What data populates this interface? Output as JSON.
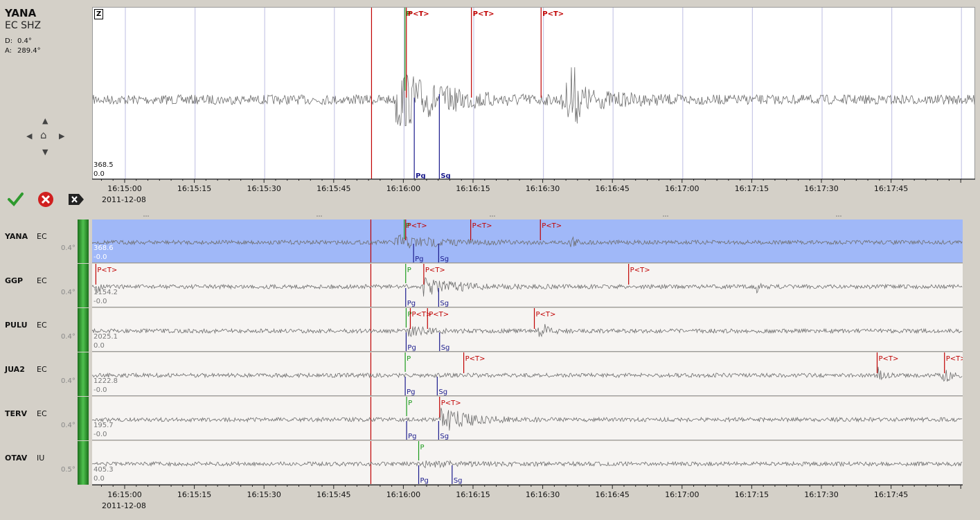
{
  "station": {
    "code": "YANA",
    "channel": "EC SHZ",
    "distance_label": "D:",
    "distance": "0.4°",
    "azimuth_label": "A:",
    "azimuth": "289.4°"
  },
  "main_trace": {
    "component": "Z",
    "amp_max": "368.5",
    "amp_min": "0.0"
  },
  "time_axis": {
    "ticks": [
      "16:15:00",
      "16:15:15",
      "16:15:30",
      "16:15:45",
      "16:16:00",
      "16:16:15",
      "16:16:30",
      "16:16:45",
      "16:17:00",
      "16:17:15",
      "16:17:30",
      "16:17:45"
    ],
    "date": "2011-12-08"
  },
  "pick_labels": {
    "theoretical": "P<T>",
    "p": "P",
    "pg": "Pg",
    "sg": "Sg"
  },
  "actions": [
    {
      "name": "accept",
      "icon": "checkmark-icon"
    },
    {
      "name": "reject",
      "icon": "red-x-icon"
    },
    {
      "name": "clear",
      "icon": "clear-x-icon"
    }
  ],
  "colors": {
    "selected_row": "#a0b8f8",
    "trace": "#6e6e6e",
    "pick_red": "#c00000",
    "pick_green": "#1a9a1a",
    "pick_blue": "#1a1a8c",
    "bar_green": "#2e9a2e"
  },
  "rows": [
    {
      "name": "YANA",
      "net": "EC",
      "dist": "0.4°",
      "amp_max": "368.6",
      "amp_min": "-0.0",
      "selected": true
    },
    {
      "name": "GGP",
      "net": "EC",
      "dist": "0.4°",
      "amp_max": "1154.2",
      "amp_min": "-0.0",
      "selected": false
    },
    {
      "name": "PULU",
      "net": "EC",
      "dist": "0.4°",
      "amp_max": "2025.1",
      "amp_min": "0.0",
      "selected": false
    },
    {
      "name": "JUA2",
      "net": "EC",
      "dist": "0.4°",
      "amp_max": "1222.8",
      "amp_min": "-0.0",
      "selected": false
    },
    {
      "name": "TERV",
      "net": "EC",
      "dist": "0.4°",
      "amp_max": "195.7",
      "amp_min": "-0.0",
      "selected": false
    },
    {
      "name": "OTAV",
      "net": "IU",
      "dist": "0.5°",
      "amp_max": "405.3",
      "amp_min": "0.0",
      "selected": false
    }
  ]
}
